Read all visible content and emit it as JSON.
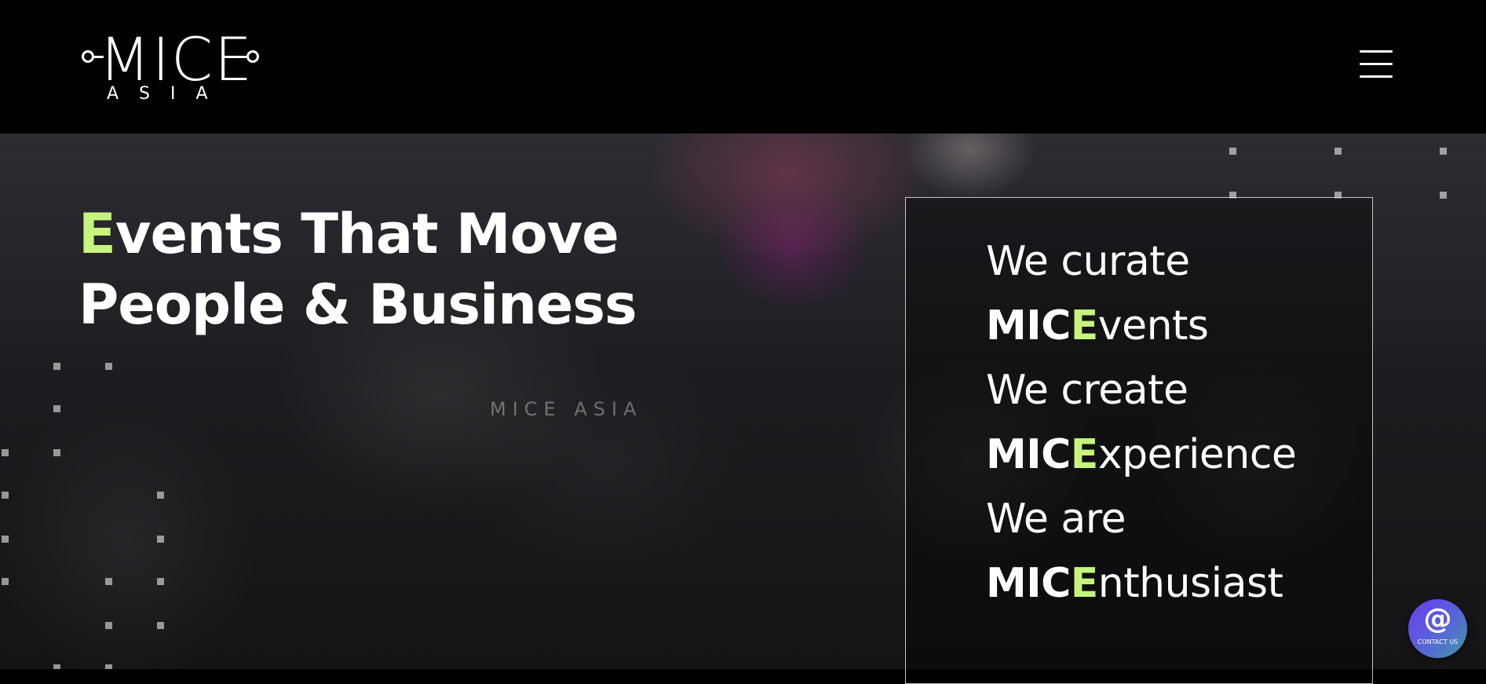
{
  "header": {
    "logo": {
      "word": "MICE",
      "sub": "ASIA"
    },
    "menu_icon": "hamburger-menu-icon"
  },
  "hero": {
    "background_text": "MICE ASIA",
    "headline": {
      "accent_letter": "E",
      "line1_rest": "vents That Move",
      "line2": "People & Business"
    },
    "taglines": [
      {
        "bold": "",
        "accent": "",
        "rest": "We curate"
      },
      {
        "bold": "MIC",
        "accent": "E",
        "rest": "vents"
      },
      {
        "bold": "",
        "accent": "",
        "rest": "We create"
      },
      {
        "bold": "MIC",
        "accent": "E",
        "rest": "xperience"
      },
      {
        "bold": "",
        "accent": "",
        "rest": "We are"
      },
      {
        "bold": "MIC",
        "accent": "E",
        "rest": "nthusiast"
      }
    ]
  },
  "contact_button": {
    "icon": "at-sign-icon",
    "symbol": "@",
    "label": "CONTACT US"
  },
  "colors": {
    "accent": "#c7f47d",
    "header_bg": "#000000",
    "text": "#ffffff",
    "fab_gradient_start": "#6a3cf0",
    "fab_gradient_end": "#3f9aa5"
  }
}
